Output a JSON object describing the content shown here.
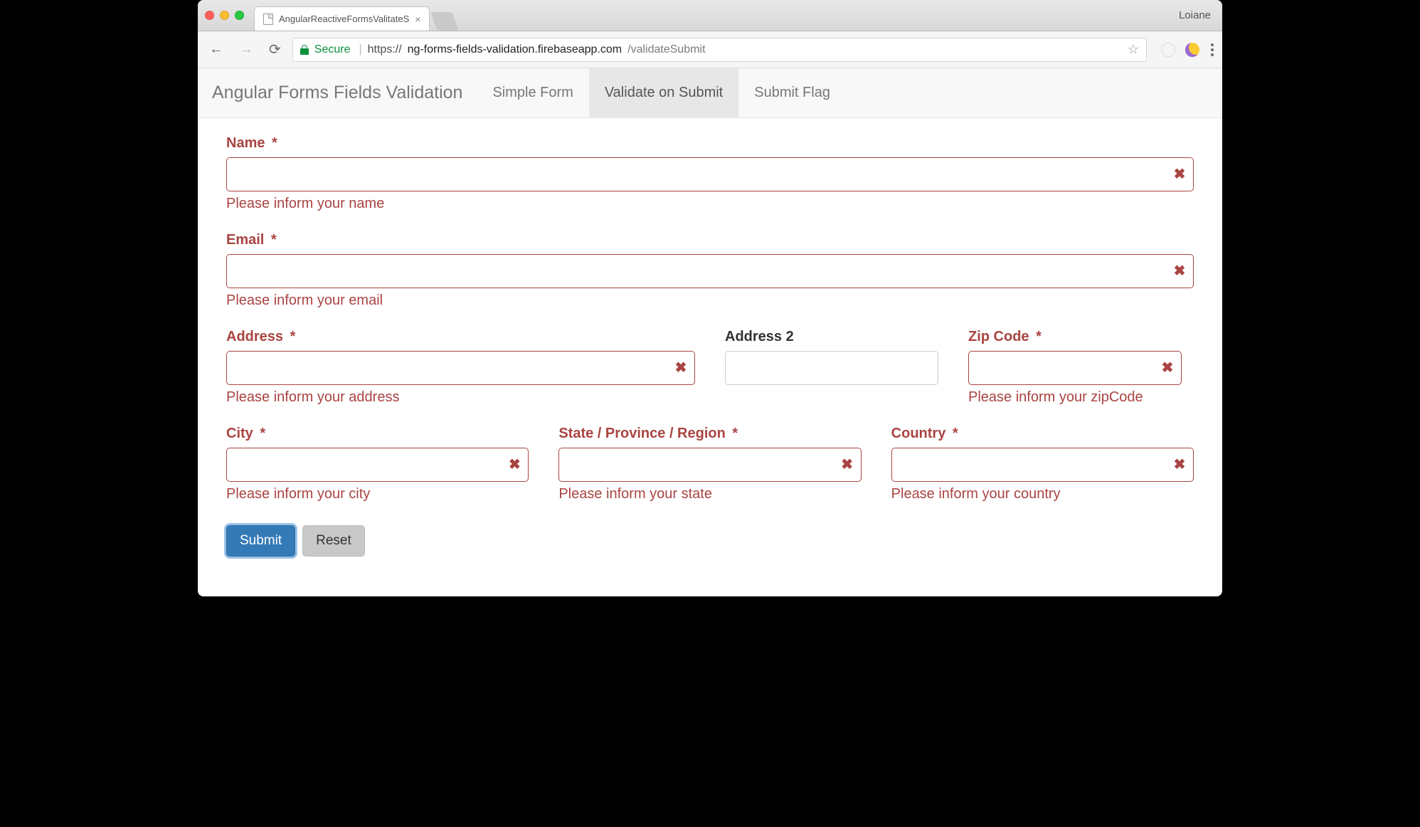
{
  "chrome": {
    "tab_title": "AngularReactiveFormsValitateS",
    "profile_name": "Loiane"
  },
  "omnibox": {
    "secure_label": "Secure",
    "scheme": "https",
    "host": "ng-forms-fields-validation.firebaseapp.com",
    "path": "/validateSubmit"
  },
  "navbar": {
    "brand": "Angular Forms Fields Validation",
    "items": [
      {
        "label": "Simple Form",
        "active": false
      },
      {
        "label": "Validate on Submit",
        "active": true
      },
      {
        "label": "Submit Flag",
        "active": false
      }
    ]
  },
  "form": {
    "fields": {
      "name": {
        "label": "Name",
        "required": true,
        "value": "",
        "error": "Please inform your name",
        "has_error": true
      },
      "email": {
        "label": "Email",
        "required": true,
        "value": "",
        "error": "Please inform your email",
        "has_error": true
      },
      "address": {
        "label": "Address",
        "required": true,
        "value": "",
        "error": "Please inform your address",
        "has_error": true
      },
      "address2": {
        "label": "Address 2",
        "required": false,
        "value": "",
        "error": "",
        "has_error": false
      },
      "zip": {
        "label": "Zip Code",
        "required": true,
        "value": "",
        "error": "Please inform your zipCode",
        "has_error": true
      },
      "city": {
        "label": "City",
        "required": true,
        "value": "",
        "error": "Please inform your city",
        "has_error": true
      },
      "state": {
        "label": "State / Province / Region",
        "required": true,
        "value": "",
        "error": "Please inform your state",
        "has_error": true
      },
      "country": {
        "label": "Country",
        "required": true,
        "value": "",
        "error": "Please inform your country",
        "has_error": true
      }
    },
    "buttons": {
      "submit": "Submit",
      "reset": "Reset"
    }
  }
}
